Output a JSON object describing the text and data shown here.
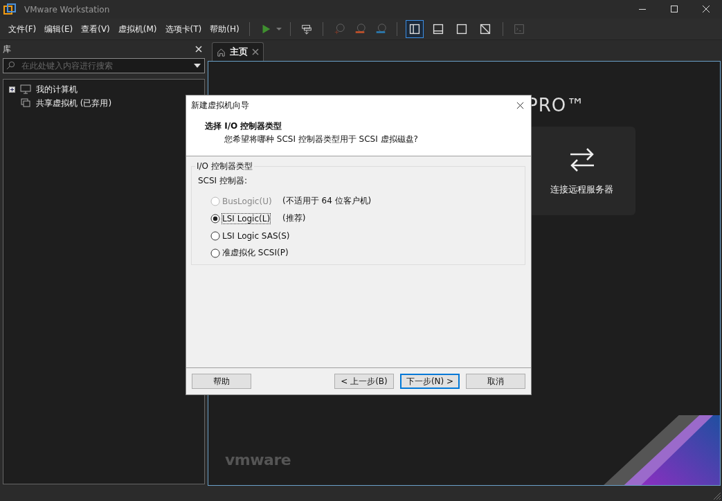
{
  "window": {
    "title": "VMware Workstation"
  },
  "menu": [
    "文件(F)",
    "编辑(E)",
    "查看(V)",
    "虚拟机(M)",
    "选项卡(T)",
    "帮助(H)"
  ],
  "toolbar": {
    "views": [
      {
        "selected": true
      },
      {
        "selected": false
      },
      {
        "selected": false
      },
      {
        "selected": false
      }
    ]
  },
  "library": {
    "title": "库",
    "search": {
      "placeholder": "在此处键入内容进行搜索"
    },
    "items": [
      {
        "label": "我的计算机",
        "kind": "computer",
        "expanded": false
      },
      {
        "label": "共享虚拟机 (已弃用)",
        "kind": "shared"
      }
    ]
  },
  "tabs": [
    {
      "label": "主页",
      "selected": true
    }
  ],
  "home": {
    "brand": "PRO™",
    "card": "连接远程服务器",
    "logo": "vmware"
  },
  "dialog": {
    "title": "新建虚拟机向导",
    "heading": "选择 I/O 控制器类型",
    "subheading": "您希望将哪种 SCSI 控制器类型用于 SCSI 虚拟磁盘?",
    "group": "I/O 控制器类型",
    "field_label": "SCSI 控制器:",
    "options": [
      {
        "label": "BusLogic(U)",
        "note": "(不适用于 64 位客户机)",
        "selected": false,
        "disabled": true
      },
      {
        "label": "LSI Logic(L)",
        "note": "(推荐)",
        "selected": true,
        "disabled": false
      },
      {
        "label": "LSI Logic SAS(S)",
        "selected": false,
        "disabled": false
      },
      {
        "label": "准虚拟化 SCSI(P)",
        "selected": false,
        "disabled": false
      }
    ],
    "buttons": [
      {
        "label": "帮助",
        "default": false
      },
      {
        "label": "< 上一步(B)",
        "default": false
      },
      {
        "label": "下一步(N) >",
        "default": true
      },
      {
        "label": "取消",
        "default": false
      }
    ]
  }
}
